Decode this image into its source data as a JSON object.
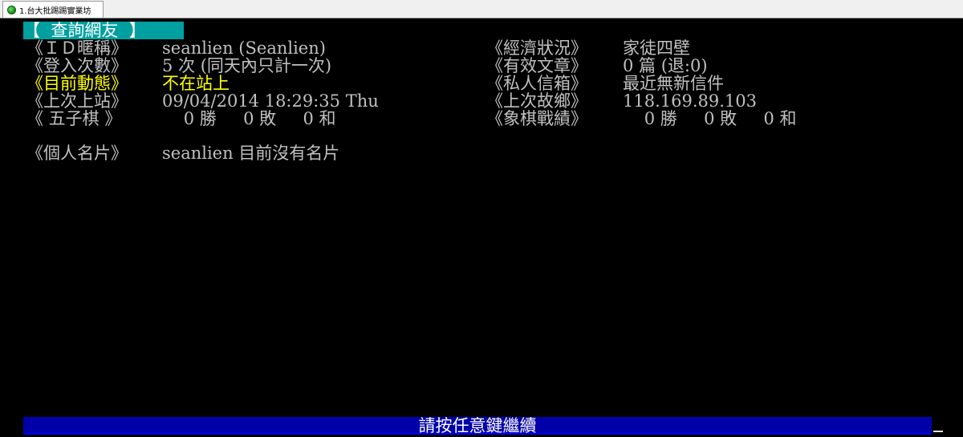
{
  "window": {
    "tab_label": "1.台大批踢踢實業坊"
  },
  "header": {
    "title": "【  查詢網友  】"
  },
  "profile": {
    "id_label": "《ＩＤ暱稱》",
    "id_value": "seanlien (Seanlien)",
    "economy_label": "《經濟狀況》",
    "economy_value": "家徒四壁",
    "login_label": "《登入次數》",
    "login_value": "5 次 (同天內只計一次)",
    "posts_label": "《有效文章》",
    "posts_value": "0 篇 (退:0)",
    "status_label": "《目前動態》",
    "status_value": "不在站上",
    "mail_label": "《私人信箱》",
    "mail_value": "最近無新信件",
    "last_login_label": "《上次上站》",
    "last_login_value": "09/04/2014 18:29:35 Thu",
    "last_ip_label": "《上次故鄉》",
    "last_ip_value": "118.169.89.103",
    "gomoku_label": "《 五子棋 》",
    "gomoku_value": "    0 勝     0 敗     0 和",
    "chess_label": "《象棋戰績》",
    "chess_value": "    0 勝     0 敗     0 和"
  },
  "card": {
    "label": "《個人名片》",
    "value": "seanlien 目前沒有名片"
  },
  "footer": {
    "prompt": "請按任意鍵繼續"
  },
  "colors": {
    "background": "#000000",
    "text": "#c0c0c0",
    "highlight": "#ffff00",
    "title_bg": "#00a0a0",
    "footer_bg": "#0000aa"
  }
}
